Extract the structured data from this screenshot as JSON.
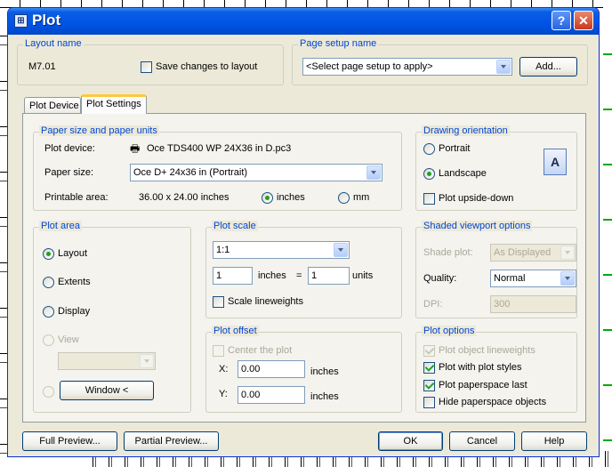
{
  "window": {
    "title": "Plot",
    "help_label": "?",
    "close_label": "✕"
  },
  "layout_name": {
    "group_label": "Layout name",
    "value": "M7.01",
    "save_changes_label": "Save changes to layout"
  },
  "page_setup": {
    "group_label": "Page setup name",
    "selected": "<Select page setup to apply>",
    "add_label": "Add..."
  },
  "tabs": [
    {
      "label": "Plot Device"
    },
    {
      "label": "Plot Settings"
    }
  ],
  "paper": {
    "group_label": "Paper size and paper units",
    "plot_device_label": "Plot device:",
    "plot_device_value": "Oce TDS400 WP 24X36 in D.pc3",
    "paper_size_label": "Paper size:",
    "paper_size_value": "Oce D+ 24x36 in (Portrait)",
    "printable_area_label": "Printable area:",
    "printable_area_value": "36.00 x 24.00 inches",
    "units_inches": "inches",
    "units_mm": "mm"
  },
  "orientation": {
    "group_label": "Drawing orientation",
    "portrait": "Portrait",
    "landscape": "Landscape",
    "upside_down": "Plot upside-down",
    "icon_glyph": "A"
  },
  "plot_area": {
    "group_label": "Plot area",
    "layout": "Layout",
    "extents": "Extents",
    "display": "Display",
    "view": "View",
    "window_button": "Window <"
  },
  "plot_scale": {
    "group_label": "Plot scale",
    "scale_value": "1:1",
    "left_value": "1",
    "left_unit": "inches",
    "equals": "=",
    "right_value": "1",
    "right_unit": "units",
    "scale_lineweights": "Scale lineweights"
  },
  "plot_offset": {
    "group_label": "Plot offset",
    "center": "Center the plot",
    "x_label": "X:",
    "x_value": "0.00",
    "x_unit": "inches",
    "y_label": "Y:",
    "y_value": "0.00",
    "y_unit": "inches"
  },
  "shaded_viewport": {
    "group_label": "Shaded viewport options",
    "shade_plot_label": "Shade plot:",
    "shade_plot_value": "As Displayed",
    "quality_label": "Quality:",
    "quality_value": "Normal",
    "dpi_label": "DPI:",
    "dpi_value": "300"
  },
  "plot_options": {
    "group_label": "Plot options",
    "object_lineweights": "Plot object lineweights",
    "plot_styles": "Plot with plot styles",
    "paperspace_last": "Plot paperspace last",
    "hide_paperspace": "Hide paperspace objects"
  },
  "footer": {
    "full_preview": "Full Preview...",
    "partial_preview": "Partial Preview...",
    "ok": "OK",
    "cancel": "Cancel",
    "help": "Help"
  },
  "colors": {
    "title_bar": "#0054e3",
    "group_label": "#0046d5",
    "dialog_bg": "#ece9d8",
    "check_green": "#21a121"
  }
}
